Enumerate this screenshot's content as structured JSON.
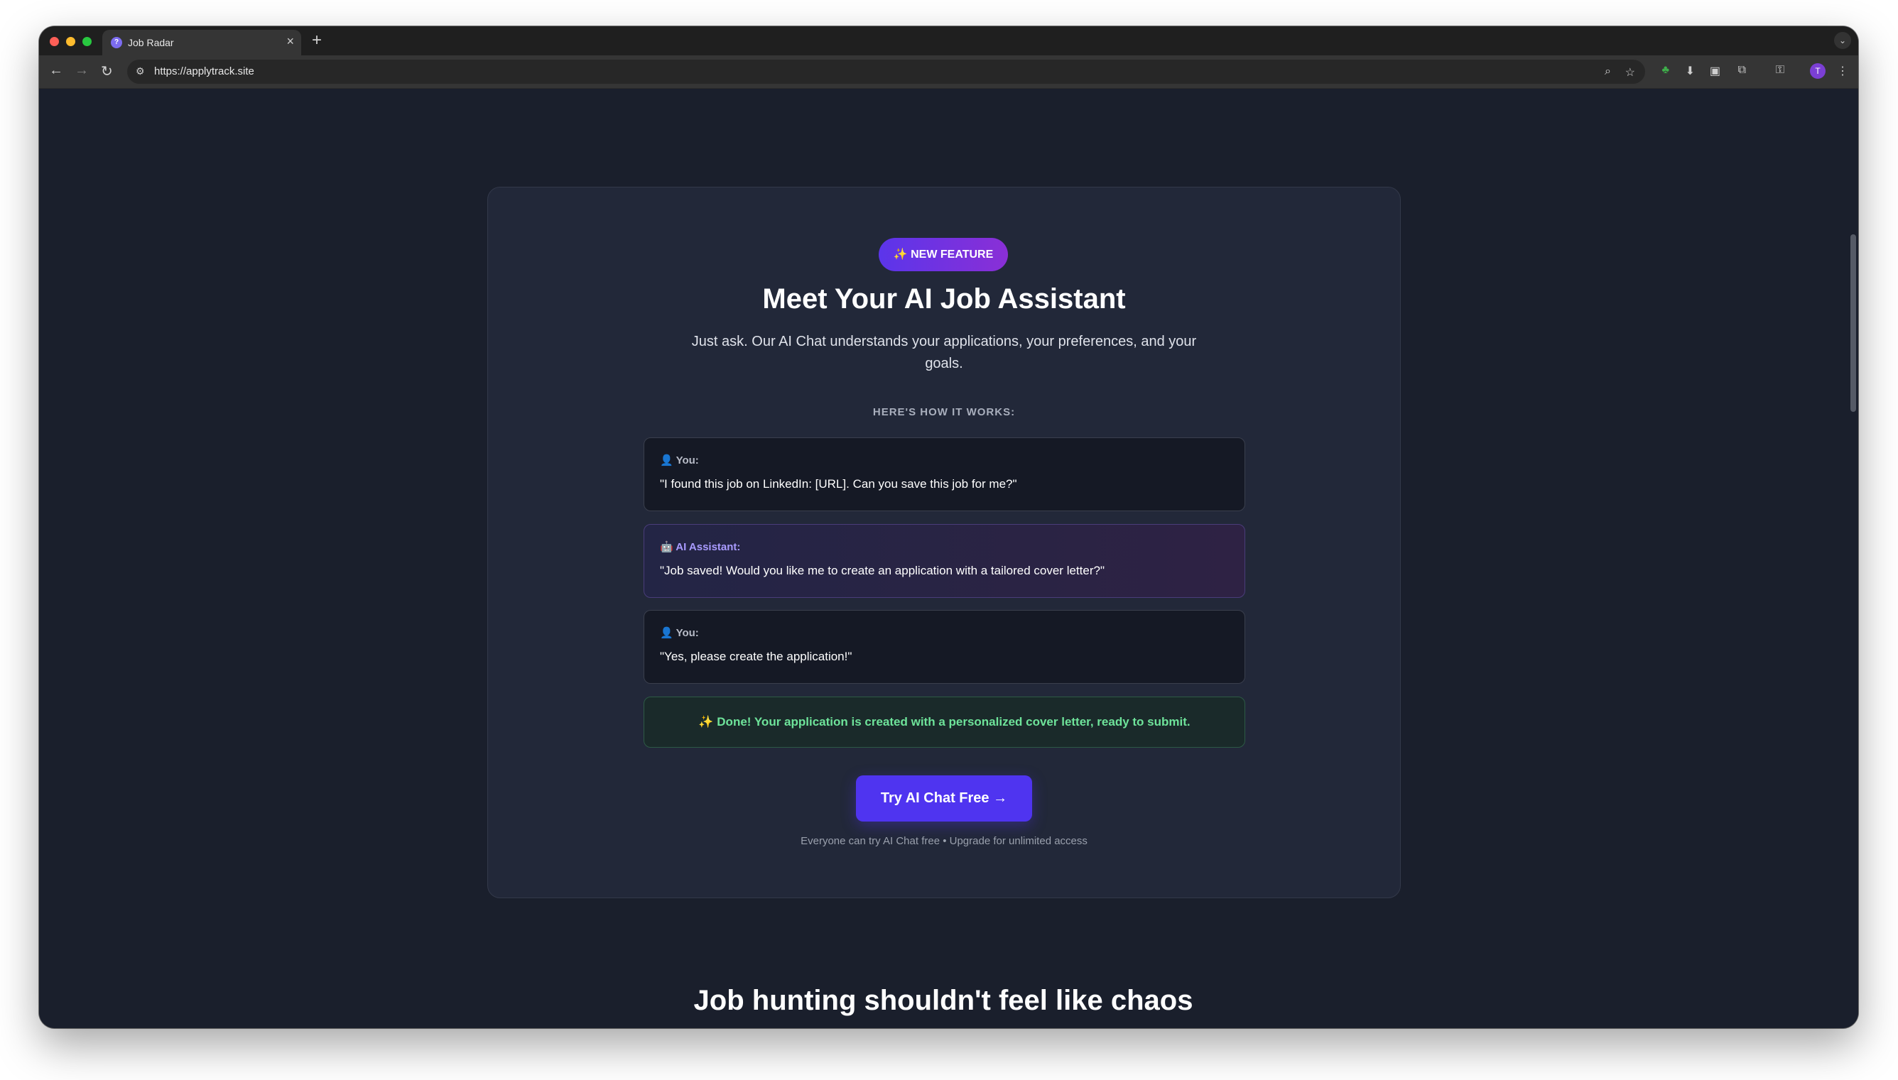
{
  "browser": {
    "tab_title": "Job Radar",
    "tab_favicon_letter": "?",
    "tab_close": "×",
    "new_tab": "+",
    "tab_menu": "⌄",
    "url": "https://applytrack.site",
    "avatar_letter": "T",
    "icons": {
      "back": "←",
      "forward": "→",
      "reload": "↻",
      "site_settings": "⚙",
      "zoom": "⌕",
      "star": "☆",
      "ext1": "♣",
      "ext2": "⬇",
      "ext3": "▣",
      "ext4": "⧉",
      "ext5": "⚿",
      "menu": "⋮"
    }
  },
  "feature": {
    "badge": "✨ NEW FEATURE",
    "title": "Meet Your AI Job Assistant",
    "subtitle": "Just ask. Our AI Chat understands your applications, your preferences, and your goals.",
    "how_label": "HERE'S HOW IT WORKS:",
    "messages": [
      {
        "label": "👤 You:",
        "text": "\"I found this job on LinkedIn: [URL]. Can you save this job for me?\""
      },
      {
        "label": "🤖 AI Assistant:",
        "text": "\"Job saved! Would you like me to create an application with a tailored cover letter?\""
      },
      {
        "label": "👤 You:",
        "text": "\"Yes, please create the application!\""
      }
    ],
    "done": "✨ Done! Your application is created with a personalized cover letter, ready to submit.",
    "cta": "Try AI Chat Free →",
    "footnote": "Everyone can try AI Chat free • Upgrade for unlimited access"
  },
  "section": {
    "heading": "Job hunting shouldn't feel like chaos"
  },
  "colors": {
    "page_bg": "#1a1f2c",
    "card_bg": "#222839",
    "accent": "#4f34f0",
    "success": "#6ee39a"
  }
}
